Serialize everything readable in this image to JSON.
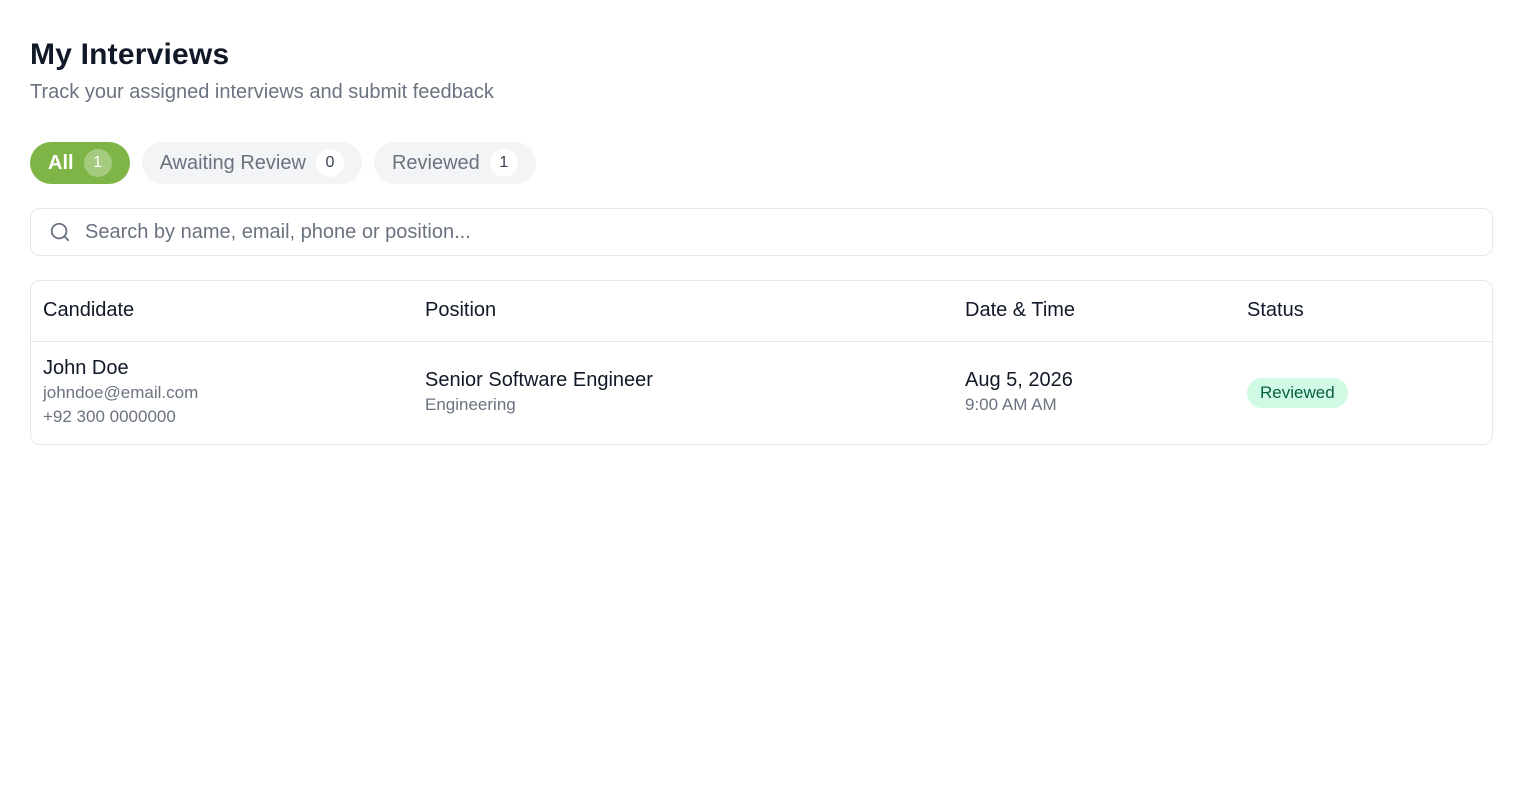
{
  "header": {
    "title": "My Interviews",
    "subtitle": "Track your assigned interviews and submit feedback"
  },
  "tabs": [
    {
      "label": "All",
      "count": "1",
      "active": true
    },
    {
      "label": "Awaiting Review",
      "count": "0",
      "active": false
    },
    {
      "label": "Reviewed",
      "count": "1",
      "active": false
    }
  ],
  "search": {
    "icon": "search-icon",
    "placeholder": "Search by name, email, phone or position...",
    "value": ""
  },
  "table": {
    "columns": [
      "Candidate",
      "Position",
      "Date & Time",
      "Status"
    ],
    "rows": [
      {
        "name": "John Doe",
        "email": "johndoe@email.com",
        "phone": "+92 300 0000000",
        "position": "Senior Software Engineer",
        "department": "Engineering",
        "date": "Aug 5, 2026",
        "time": "9:00 AM AM",
        "status": "Reviewed"
      }
    ]
  },
  "colors": {
    "accent": "#7fb547",
    "status_reviewed_bg": "#d1fae5",
    "status_reviewed_text": "#065f46"
  }
}
